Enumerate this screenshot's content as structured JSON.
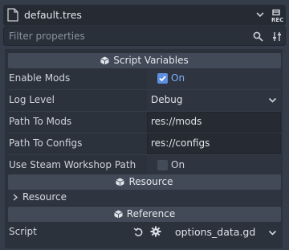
{
  "header": {
    "title": "default.tres",
    "file_icon": "resource-file-icon",
    "dropdown_icon": "chevron-down-icon",
    "object_icon": "object-properties-icon"
  },
  "filter": {
    "placeholder": "Filter properties",
    "search_icon": "search-icon",
    "options_icon": "tune-icon"
  },
  "sections": {
    "script_variables": "Script Variables",
    "resource": "Resource",
    "reference": "Reference"
  },
  "properties": {
    "enable_mods": {
      "label": "Enable Mods",
      "value": "On",
      "checked": true
    },
    "log_level": {
      "label": "Log Level",
      "value": "Debug"
    },
    "path_to_mods": {
      "label": "Path To Mods",
      "value": "res://mods"
    },
    "path_to_configs": {
      "label": "Path To Configs",
      "value": "res://configs"
    },
    "use_steam_workshop_path": {
      "label": "Use Steam Workshop Path",
      "value": "On",
      "checked": false
    }
  },
  "resource_group": {
    "label": "Resource"
  },
  "script": {
    "label": "Script",
    "value": "options_data.gd"
  },
  "colors": {
    "accent": "#5d8fe0",
    "checked_text": "#7eb0ff",
    "background": "#363d4a",
    "panel": "#2c323c"
  }
}
